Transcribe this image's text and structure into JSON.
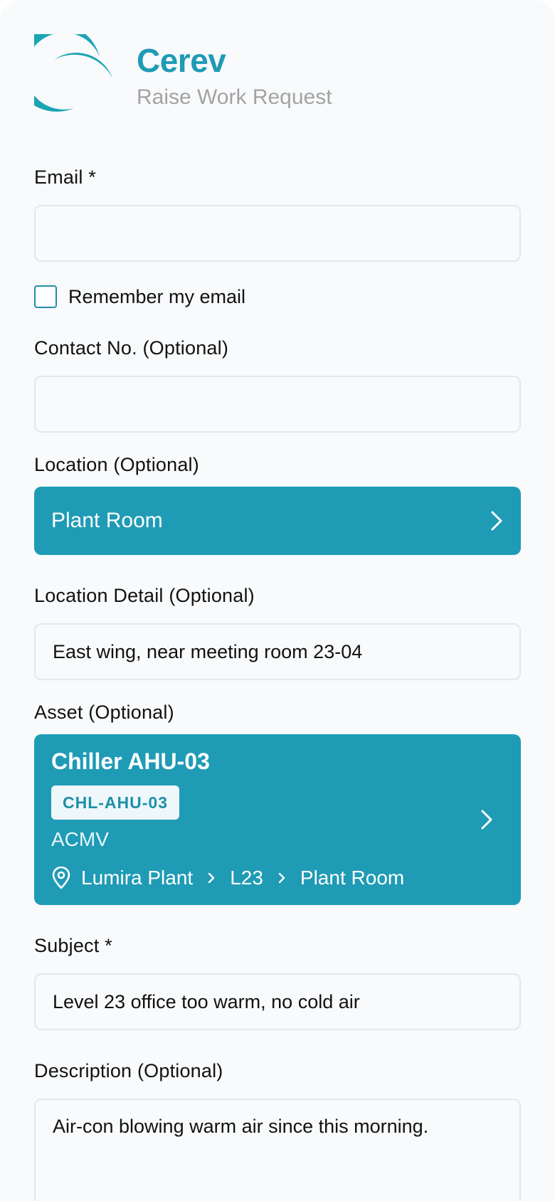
{
  "header": {
    "brand": "Cerev",
    "subtitle": "Raise Work Request",
    "accent_color": "#1f9bb5"
  },
  "email": {
    "label": "Email *",
    "value": "",
    "remember_label": "Remember my email",
    "remember_checked": false
  },
  "contact": {
    "label": "Contact No. (Optional)",
    "value": ""
  },
  "location": {
    "label": "Location (Optional)",
    "value": "Plant Room"
  },
  "location_detail": {
    "label": "Location Detail (Optional)",
    "value": "East wing, near meeting room 23-04"
  },
  "asset": {
    "label": "Asset (Optional)",
    "name": "Chiller AHU-03",
    "code": "CHL-AHU-03",
    "category": "ACMV",
    "path": [
      "Lumira Plant",
      "L23",
      "Plant Room"
    ]
  },
  "subject": {
    "label": "Subject *",
    "value": "Level 23 office too warm, no cold air"
  },
  "description": {
    "label": "Description (Optional)",
    "value": "Air-con blowing warm air since this morning."
  }
}
